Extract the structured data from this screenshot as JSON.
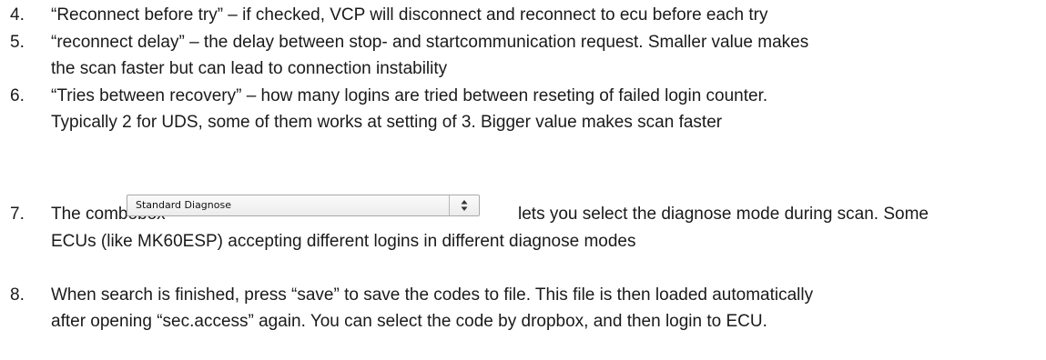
{
  "items": [
    {
      "number": "4.",
      "lines": [
        "“Reconnect before try” – if checked, VCP will disconnect and reconnect to ecu before each try"
      ]
    },
    {
      "number": "5.",
      "lines": [
        "“reconnect delay” – the delay between stop- and startcommunication request. Smaller value makes",
        "the scan faster but can lead to connection instability"
      ]
    },
    {
      "number": "6.",
      "lines": [
        "“Tries between recovery” – how many logins are tried between reseting of failed login counter.",
        "Typically 2 for UDS, some of them works at setting of 3. Bigger value makes scan faster"
      ]
    },
    {
      "number": "7.",
      "intro": "The combobox",
      "combobox_value": "Standard Diagnose",
      "after_combobox": "lets you select the diagnose mode during scan. Some",
      "lines": [
        "ECUs (like MK60ESP) accepting different logins in different diagnose modes"
      ]
    },
    {
      "number": "8.",
      "lines": [
        "When search is finished, press “save” to save the codes to file. This file is then loaded automatically",
        "after opening “sec.access” again. You can select the code by dropbox, and then login to ECU."
      ]
    }
  ]
}
